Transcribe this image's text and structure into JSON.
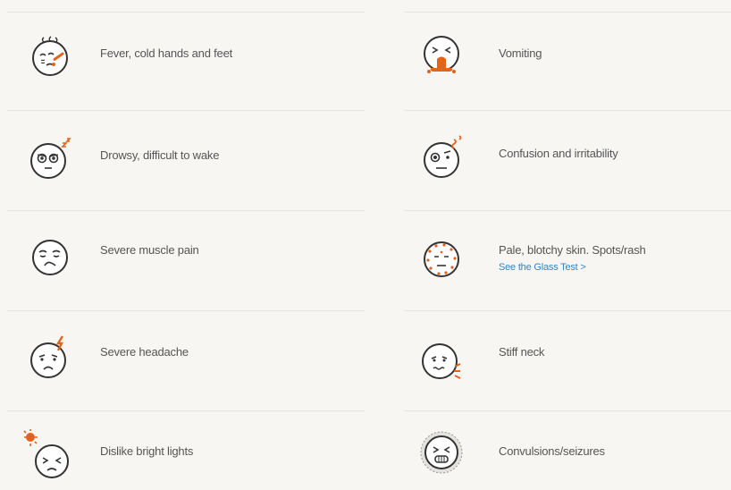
{
  "symptoms": [
    {
      "label": "Fever, cold hands and feet",
      "icon": "fever-face-icon"
    },
    {
      "label": "Vomiting",
      "icon": "vomiting-face-icon"
    },
    {
      "label": "Drowsy, difficult to wake",
      "icon": "drowsy-face-icon"
    },
    {
      "label": "Confusion and irritability",
      "icon": "confused-face-icon"
    },
    {
      "label": "Severe muscle pain",
      "icon": "pain-face-icon"
    },
    {
      "label": "Pale, blotchy skin. Spots/rash",
      "icon": "rash-face-icon",
      "link": "See the Glass Test >"
    },
    {
      "label": "Severe headache",
      "icon": "headache-face-icon"
    },
    {
      "label": "Stiff neck",
      "icon": "stiff-neck-face-icon"
    },
    {
      "label": "Dislike bright lights",
      "icon": "light-sensitivity-face-icon"
    },
    {
      "label": "Convulsions/seizures",
      "icon": "seizure-face-icon"
    }
  ],
  "colors": {
    "accent": "#e0641e",
    "link": "#2f86c6",
    "outline": "#333333"
  }
}
